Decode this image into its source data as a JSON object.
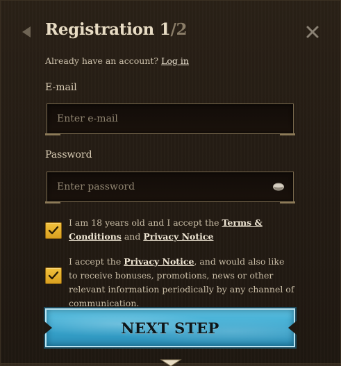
{
  "header": {
    "title": "Registration",
    "step_current": "1",
    "step_separator": "/",
    "step_total": "2"
  },
  "login_prompt": {
    "text": "Already have an account?",
    "link": "Log in"
  },
  "email": {
    "label": "E-mail",
    "placeholder": "Enter e-mail",
    "value": ""
  },
  "password": {
    "label": "Password",
    "placeholder": "Enter password",
    "value": ""
  },
  "consent_age": {
    "checked": true,
    "text_before": "I am 18 years old and I accept the ",
    "terms_link": "Terms & Conditions",
    "text_middle": " and ",
    "privacy_link": "Privacy Notice"
  },
  "consent_marketing": {
    "checked": true,
    "text_before": "I accept the ",
    "privacy_link": "Privacy Notice",
    "text_after": ", and would also like to receive bonuses, promotions, news or other relevant information periodically by any channel of communication."
  },
  "next_button": {
    "label": "NEXT STEP"
  },
  "icons": {
    "back": "chevron-left-icon",
    "close": "close-icon",
    "eye": "eye-icon",
    "check": "checkmark-icon"
  },
  "colors": {
    "background": "#241c14",
    "title": "#e8dcc4",
    "checkbox": "#e5ad2a",
    "button": "#3aa7cf"
  }
}
